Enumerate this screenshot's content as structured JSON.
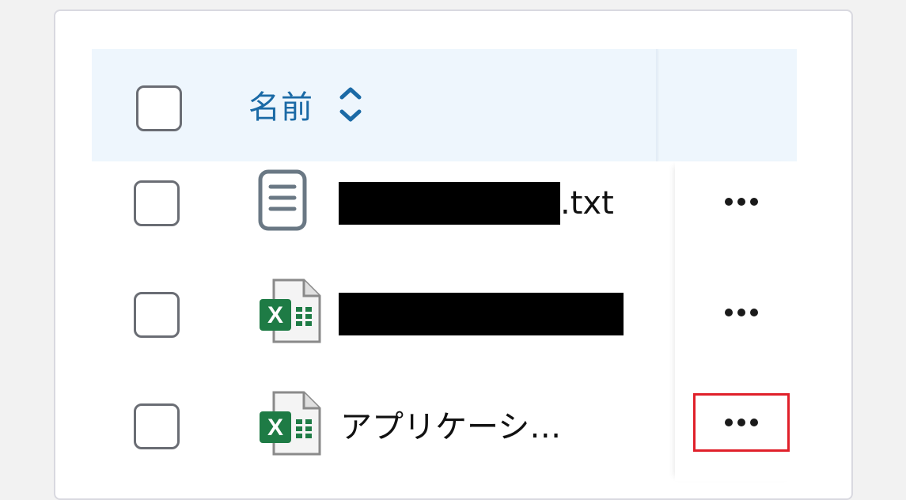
{
  "table": {
    "header": {
      "name_label": "名前"
    },
    "rows": [
      {
        "name_suffix": ".txt",
        "file_type": "text-file-icon",
        "redacted": true
      },
      {
        "name_suffix": "",
        "file_type": "excel-file-icon",
        "redacted": true
      },
      {
        "name": "アプリケーシ…",
        "file_type": "excel-file-icon",
        "redacted": false
      }
    ],
    "more_label": "•••"
  },
  "colors": {
    "header_bg": "#eef6fd",
    "header_text": "#1b6aa6",
    "excel_green": "#1e7b45",
    "highlight": "#e0202a"
  }
}
